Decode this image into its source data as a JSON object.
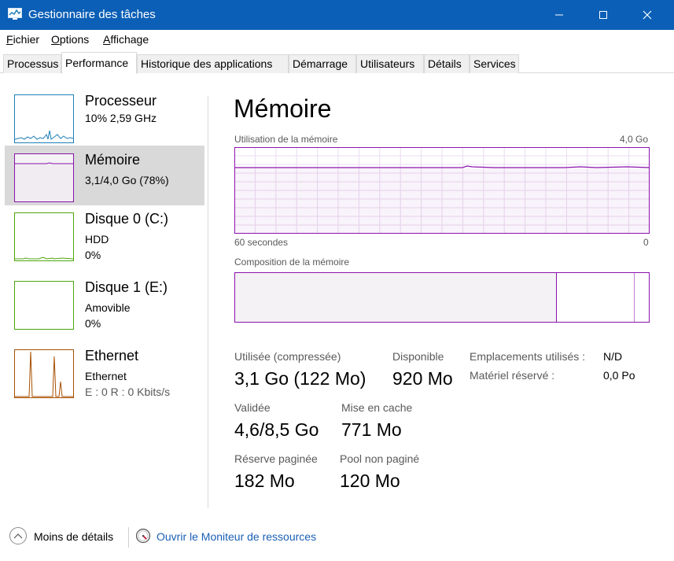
{
  "window": {
    "title": "Gestionnaire des tâches",
    "icon": "task-manager-icon"
  },
  "menu": [
    {
      "label": "Fichier",
      "accel": "F",
      "rest": "ichier"
    },
    {
      "label": "Options",
      "accel": "O",
      "rest": "ptions"
    },
    {
      "label": "Affichage",
      "accel": "A",
      "rest": "ffichage"
    }
  ],
  "tabs": [
    {
      "label": "Processus"
    },
    {
      "label": "Performance",
      "active": true
    },
    {
      "label": "Historique des applications"
    },
    {
      "label": "Démarrage"
    },
    {
      "label": "Utilisateurs"
    },
    {
      "label": "Détails"
    },
    {
      "label": "Services"
    }
  ],
  "resources": [
    {
      "name": "Processeur",
      "line1": "10%  2,59 GHz",
      "line2": "",
      "color": "#1e7fb8"
    },
    {
      "name": "Mémoire",
      "line1": "3,1/4,0 Go (78%)",
      "line2": "",
      "color": "#8b12ae",
      "selected": true
    },
    {
      "name": "Disque 0 (C:)",
      "line1": "HDD",
      "line2": "0%",
      "color": "#4da60c"
    },
    {
      "name": "Disque 1 (E:)",
      "line1": "Amovible",
      "line2": "0%",
      "color": "#4da60c"
    },
    {
      "name": "Ethernet",
      "line1": "Ethernet",
      "line2": "E : 0  R : 0 Kbits/s",
      "color": "#a74f01"
    }
  ],
  "detail": {
    "title": "Mémoire",
    "usage_label": "Utilisation de la mémoire",
    "usage_max": "4,0 Go",
    "time_label": "60 secondes",
    "time_end": "0",
    "composition_label": "Composition de la mémoire",
    "usage_fraction": 0.78,
    "stats": {
      "used_label": "Utilisée (compressée)",
      "used_value": "3,1 Go (122 Mo)",
      "available_label": "Disponible",
      "available_value": "920 Mo",
      "committed_label": "Validée",
      "committed_value": "4,6/8,5 Go",
      "cached_label": "Mise en cache",
      "cached_value": "771 Mo",
      "paged_label": "Réserve paginée",
      "paged_value": "182 Mo",
      "nonpaged_label": "Pool non paginé",
      "nonpaged_value": "120 Mo"
    },
    "kv": {
      "slots_label": "Emplacements utilisés :",
      "slots_value": "N/D",
      "reserved_label": "Matériel réservé :",
      "reserved_value": "0,0 Po"
    }
  },
  "footer": {
    "fewer_details": "Moins de détails",
    "monitor_link": "Ouvrir le Moniteur de ressources"
  },
  "colors": {
    "titlebar": "#0b5fb6",
    "memory": "#8b12ae",
    "selected": "#d9d9d9",
    "link": "#1a5fb4"
  }
}
